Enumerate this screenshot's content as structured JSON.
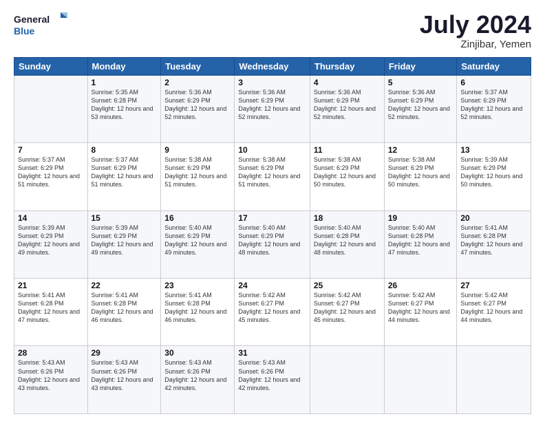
{
  "logo": {
    "line1": "General",
    "line2": "Blue"
  },
  "title": "July 2024",
  "location": "Zinjibar, Yemen",
  "days_header": [
    "Sunday",
    "Monday",
    "Tuesday",
    "Wednesday",
    "Thursday",
    "Friday",
    "Saturday"
  ],
  "weeks": [
    [
      {
        "day": "",
        "sunrise": "",
        "sunset": "",
        "daylight": ""
      },
      {
        "day": "1",
        "sunrise": "Sunrise: 5:35 AM",
        "sunset": "Sunset: 6:28 PM",
        "daylight": "Daylight: 12 hours and 53 minutes."
      },
      {
        "day": "2",
        "sunrise": "Sunrise: 5:36 AM",
        "sunset": "Sunset: 6:29 PM",
        "daylight": "Daylight: 12 hours and 52 minutes."
      },
      {
        "day": "3",
        "sunrise": "Sunrise: 5:36 AM",
        "sunset": "Sunset: 6:29 PM",
        "daylight": "Daylight: 12 hours and 52 minutes."
      },
      {
        "day": "4",
        "sunrise": "Sunrise: 5:36 AM",
        "sunset": "Sunset: 6:29 PM",
        "daylight": "Daylight: 12 hours and 52 minutes."
      },
      {
        "day": "5",
        "sunrise": "Sunrise: 5:36 AM",
        "sunset": "Sunset: 6:29 PM",
        "daylight": "Daylight: 12 hours and 52 minutes."
      },
      {
        "day": "6",
        "sunrise": "Sunrise: 5:37 AM",
        "sunset": "Sunset: 6:29 PM",
        "daylight": "Daylight: 12 hours and 52 minutes."
      }
    ],
    [
      {
        "day": "7",
        "sunrise": "Sunrise: 5:37 AM",
        "sunset": "Sunset: 6:29 PM",
        "daylight": "Daylight: 12 hours and 51 minutes."
      },
      {
        "day": "8",
        "sunrise": "Sunrise: 5:37 AM",
        "sunset": "Sunset: 6:29 PM",
        "daylight": "Daylight: 12 hours and 51 minutes."
      },
      {
        "day": "9",
        "sunrise": "Sunrise: 5:38 AM",
        "sunset": "Sunset: 6:29 PM",
        "daylight": "Daylight: 12 hours and 51 minutes."
      },
      {
        "day": "10",
        "sunrise": "Sunrise: 5:38 AM",
        "sunset": "Sunset: 6:29 PM",
        "daylight": "Daylight: 12 hours and 51 minutes."
      },
      {
        "day": "11",
        "sunrise": "Sunrise: 5:38 AM",
        "sunset": "Sunset: 6:29 PM",
        "daylight": "Daylight: 12 hours and 50 minutes."
      },
      {
        "day": "12",
        "sunrise": "Sunrise: 5:38 AM",
        "sunset": "Sunset: 6:29 PM",
        "daylight": "Daylight: 12 hours and 50 minutes."
      },
      {
        "day": "13",
        "sunrise": "Sunrise: 5:39 AM",
        "sunset": "Sunset: 6:29 PM",
        "daylight": "Daylight: 12 hours and 50 minutes."
      }
    ],
    [
      {
        "day": "14",
        "sunrise": "Sunrise: 5:39 AM",
        "sunset": "Sunset: 6:29 PM",
        "daylight": "Daylight: 12 hours and 49 minutes."
      },
      {
        "day": "15",
        "sunrise": "Sunrise: 5:39 AM",
        "sunset": "Sunset: 6:29 PM",
        "daylight": "Daylight: 12 hours and 49 minutes."
      },
      {
        "day": "16",
        "sunrise": "Sunrise: 5:40 AM",
        "sunset": "Sunset: 6:29 PM",
        "daylight": "Daylight: 12 hours and 49 minutes."
      },
      {
        "day": "17",
        "sunrise": "Sunrise: 5:40 AM",
        "sunset": "Sunset: 6:29 PM",
        "daylight": "Daylight: 12 hours and 48 minutes."
      },
      {
        "day": "18",
        "sunrise": "Sunrise: 5:40 AM",
        "sunset": "Sunset: 6:28 PM",
        "daylight": "Daylight: 12 hours and 48 minutes."
      },
      {
        "day": "19",
        "sunrise": "Sunrise: 5:40 AM",
        "sunset": "Sunset: 6:28 PM",
        "daylight": "Daylight: 12 hours and 47 minutes."
      },
      {
        "day": "20",
        "sunrise": "Sunrise: 5:41 AM",
        "sunset": "Sunset: 6:28 PM",
        "daylight": "Daylight: 12 hours and 47 minutes."
      }
    ],
    [
      {
        "day": "21",
        "sunrise": "Sunrise: 5:41 AM",
        "sunset": "Sunset: 6:28 PM",
        "daylight": "Daylight: 12 hours and 47 minutes."
      },
      {
        "day": "22",
        "sunrise": "Sunrise: 5:41 AM",
        "sunset": "Sunset: 6:28 PM",
        "daylight": "Daylight: 12 hours and 46 minutes."
      },
      {
        "day": "23",
        "sunrise": "Sunrise: 5:41 AM",
        "sunset": "Sunset: 6:28 PM",
        "daylight": "Daylight: 12 hours and 46 minutes."
      },
      {
        "day": "24",
        "sunrise": "Sunrise: 5:42 AM",
        "sunset": "Sunset: 6:27 PM",
        "daylight": "Daylight: 12 hours and 45 minutes."
      },
      {
        "day": "25",
        "sunrise": "Sunrise: 5:42 AM",
        "sunset": "Sunset: 6:27 PM",
        "daylight": "Daylight: 12 hours and 45 minutes."
      },
      {
        "day": "26",
        "sunrise": "Sunrise: 5:42 AM",
        "sunset": "Sunset: 6:27 PM",
        "daylight": "Daylight: 12 hours and 44 minutes."
      },
      {
        "day": "27",
        "sunrise": "Sunrise: 5:42 AM",
        "sunset": "Sunset: 6:27 PM",
        "daylight": "Daylight: 12 hours and 44 minutes."
      }
    ],
    [
      {
        "day": "28",
        "sunrise": "Sunrise: 5:43 AM",
        "sunset": "Sunset: 6:26 PM",
        "daylight": "Daylight: 12 hours and 43 minutes."
      },
      {
        "day": "29",
        "sunrise": "Sunrise: 5:43 AM",
        "sunset": "Sunset: 6:26 PM",
        "daylight": "Daylight: 12 hours and 43 minutes."
      },
      {
        "day": "30",
        "sunrise": "Sunrise: 5:43 AM",
        "sunset": "Sunset: 6:26 PM",
        "daylight": "Daylight: 12 hours and 42 minutes."
      },
      {
        "day": "31",
        "sunrise": "Sunrise: 5:43 AM",
        "sunset": "Sunset: 6:26 PM",
        "daylight": "Daylight: 12 hours and 42 minutes."
      },
      {
        "day": "",
        "sunrise": "",
        "sunset": "",
        "daylight": ""
      },
      {
        "day": "",
        "sunrise": "",
        "sunset": "",
        "daylight": ""
      },
      {
        "day": "",
        "sunrise": "",
        "sunset": "",
        "daylight": ""
      }
    ]
  ]
}
